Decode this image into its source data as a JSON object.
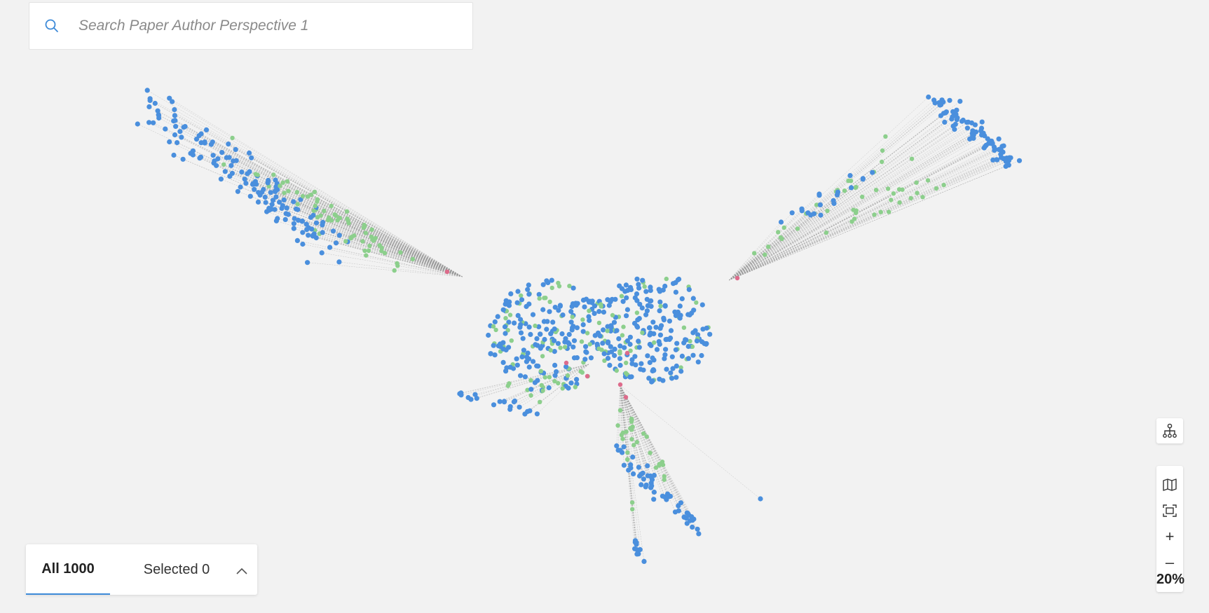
{
  "search": {
    "placeholder": "Search Paper Author Perspective 1",
    "value": ""
  },
  "results_tray": {
    "all_label": "All 1000",
    "selected_label": "Selected 0",
    "active_tab": "all"
  },
  "toolbar": {
    "layout_icon": "hierarchy-icon",
    "map_icon": "map-icon",
    "fit_icon": "fit-screen-icon",
    "zoom_in_label": "+",
    "zoom_out_label": "–",
    "zoom_level": "20%"
  },
  "graph": {
    "node_colors": {
      "author": "#4a8fdd",
      "paper": "#8ccf8c",
      "highlight": "#dd6b8b"
    },
    "edge_color": "#9b9b9b",
    "node_count_total": 1000
  }
}
